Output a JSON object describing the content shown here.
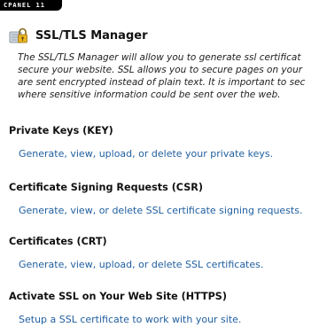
{
  "header": {
    "brand_tab": "CPANEL 11"
  },
  "page": {
    "title": "SSL/TLS Manager",
    "intro_lines": [
      "The SSL/TLS Manager will allow you to generate ssl certificat",
      "secure your website. SSL allows you to secure pages on your",
      "are sent encrypted instead of plain text. It is important to sec",
      "where sensitive information could be sent over the web."
    ]
  },
  "sections": [
    {
      "heading": "Private Keys (KEY)",
      "link": "Generate, view, upload, or delete your private keys."
    },
    {
      "heading": "Certificate Signing Requests (CSR)",
      "link": "Generate, view, or delete SSL certificate signing requests."
    },
    {
      "heading": "Certificates (CRT)",
      "link": "Generate, view, upload, or delete SSL certificates."
    },
    {
      "heading": "Activate SSL on Your Web Site (HTTPS)",
      "link": "Setup a SSL certificate to work with your site."
    }
  ],
  "icons": {
    "title_icon": "padlock-certificate-icon"
  },
  "colors": {
    "link": "#1f5e9e",
    "heading": "#111111",
    "tab_background": "#000000"
  }
}
